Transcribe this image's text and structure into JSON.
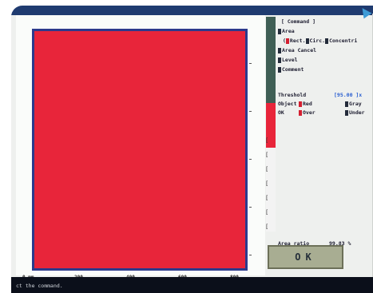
{
  "titlebar": {
    "title": ""
  },
  "command": {
    "header": "[ Command ]",
    "area": "Area",
    "rect": "Rect.",
    "circ": "Circ.",
    "concentric": "Concentri",
    "area_cancel": "Area Cancel",
    "level": "Level",
    "comment": "Comment"
  },
  "threshold": {
    "label": "Threshold",
    "value": "[95.00 ]x",
    "object_label": "Object",
    "object_red": "Red",
    "object_gray": "Gray",
    "ok_label": "OK",
    "over": "Over",
    "under": "Under"
  },
  "result": {
    "label": "Area ratio",
    "value": "99.83 %"
  },
  "ok_button": {
    "label": "OK"
  },
  "x_axis": [
    "0 mm",
    "200",
    "400",
    "600",
    "800"
  ],
  "status": {
    "message": "ct the command."
  },
  "colors": {
    "graph_fill": "#e8253a",
    "frame": "#2c3a8c",
    "sidebar": "#3f5f55",
    "button": "#a8ad92"
  }
}
